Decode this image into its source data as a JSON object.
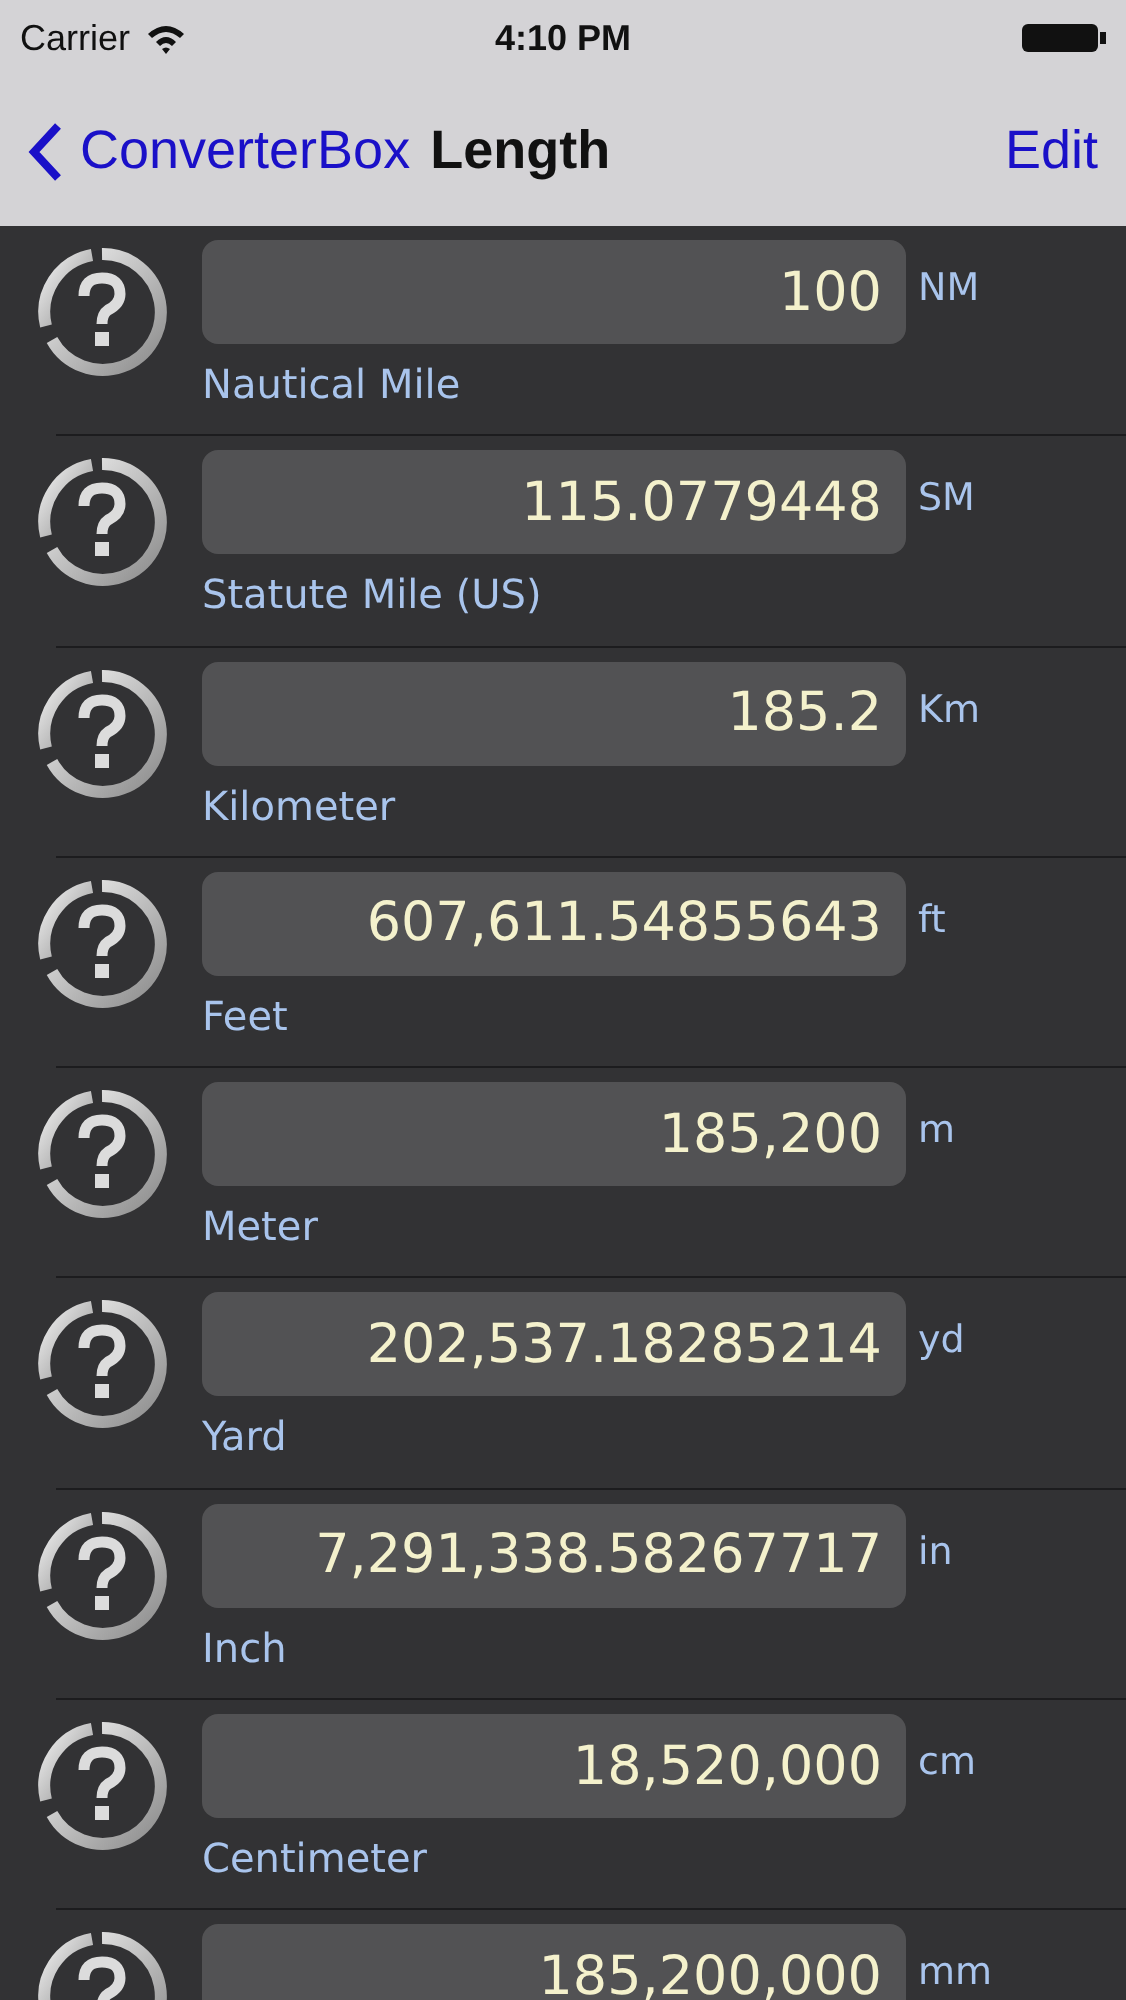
{
  "status_bar": {
    "carrier": "Carrier",
    "time": "4:10 PM"
  },
  "nav_bar": {
    "back": "ConverterBox",
    "title": "Length",
    "action": "Edit"
  },
  "units": [
    {
      "value": "100",
      "symbol": "NM",
      "name": "Nautical Mile"
    },
    {
      "value": "115.0779448",
      "symbol": "SM",
      "name": "Statute Mile (US)"
    },
    {
      "value": "185.2",
      "symbol": "Km",
      "name": "Kilometer"
    },
    {
      "value": "607,611.54855643",
      "symbol": "ft",
      "name": "Feet"
    },
    {
      "value": "185,200",
      "symbol": "m",
      "name": "Meter"
    },
    {
      "value": "202,537.18285214",
      "symbol": "yd",
      "name": "Yard"
    },
    {
      "value": "7,291,338.58267717",
      "symbol": "in",
      "name": "Inch"
    },
    {
      "value": "18,520,000",
      "symbol": "cm",
      "name": "Centimeter"
    },
    {
      "value": "185,200,000",
      "symbol": "mm"
    }
  ]
}
